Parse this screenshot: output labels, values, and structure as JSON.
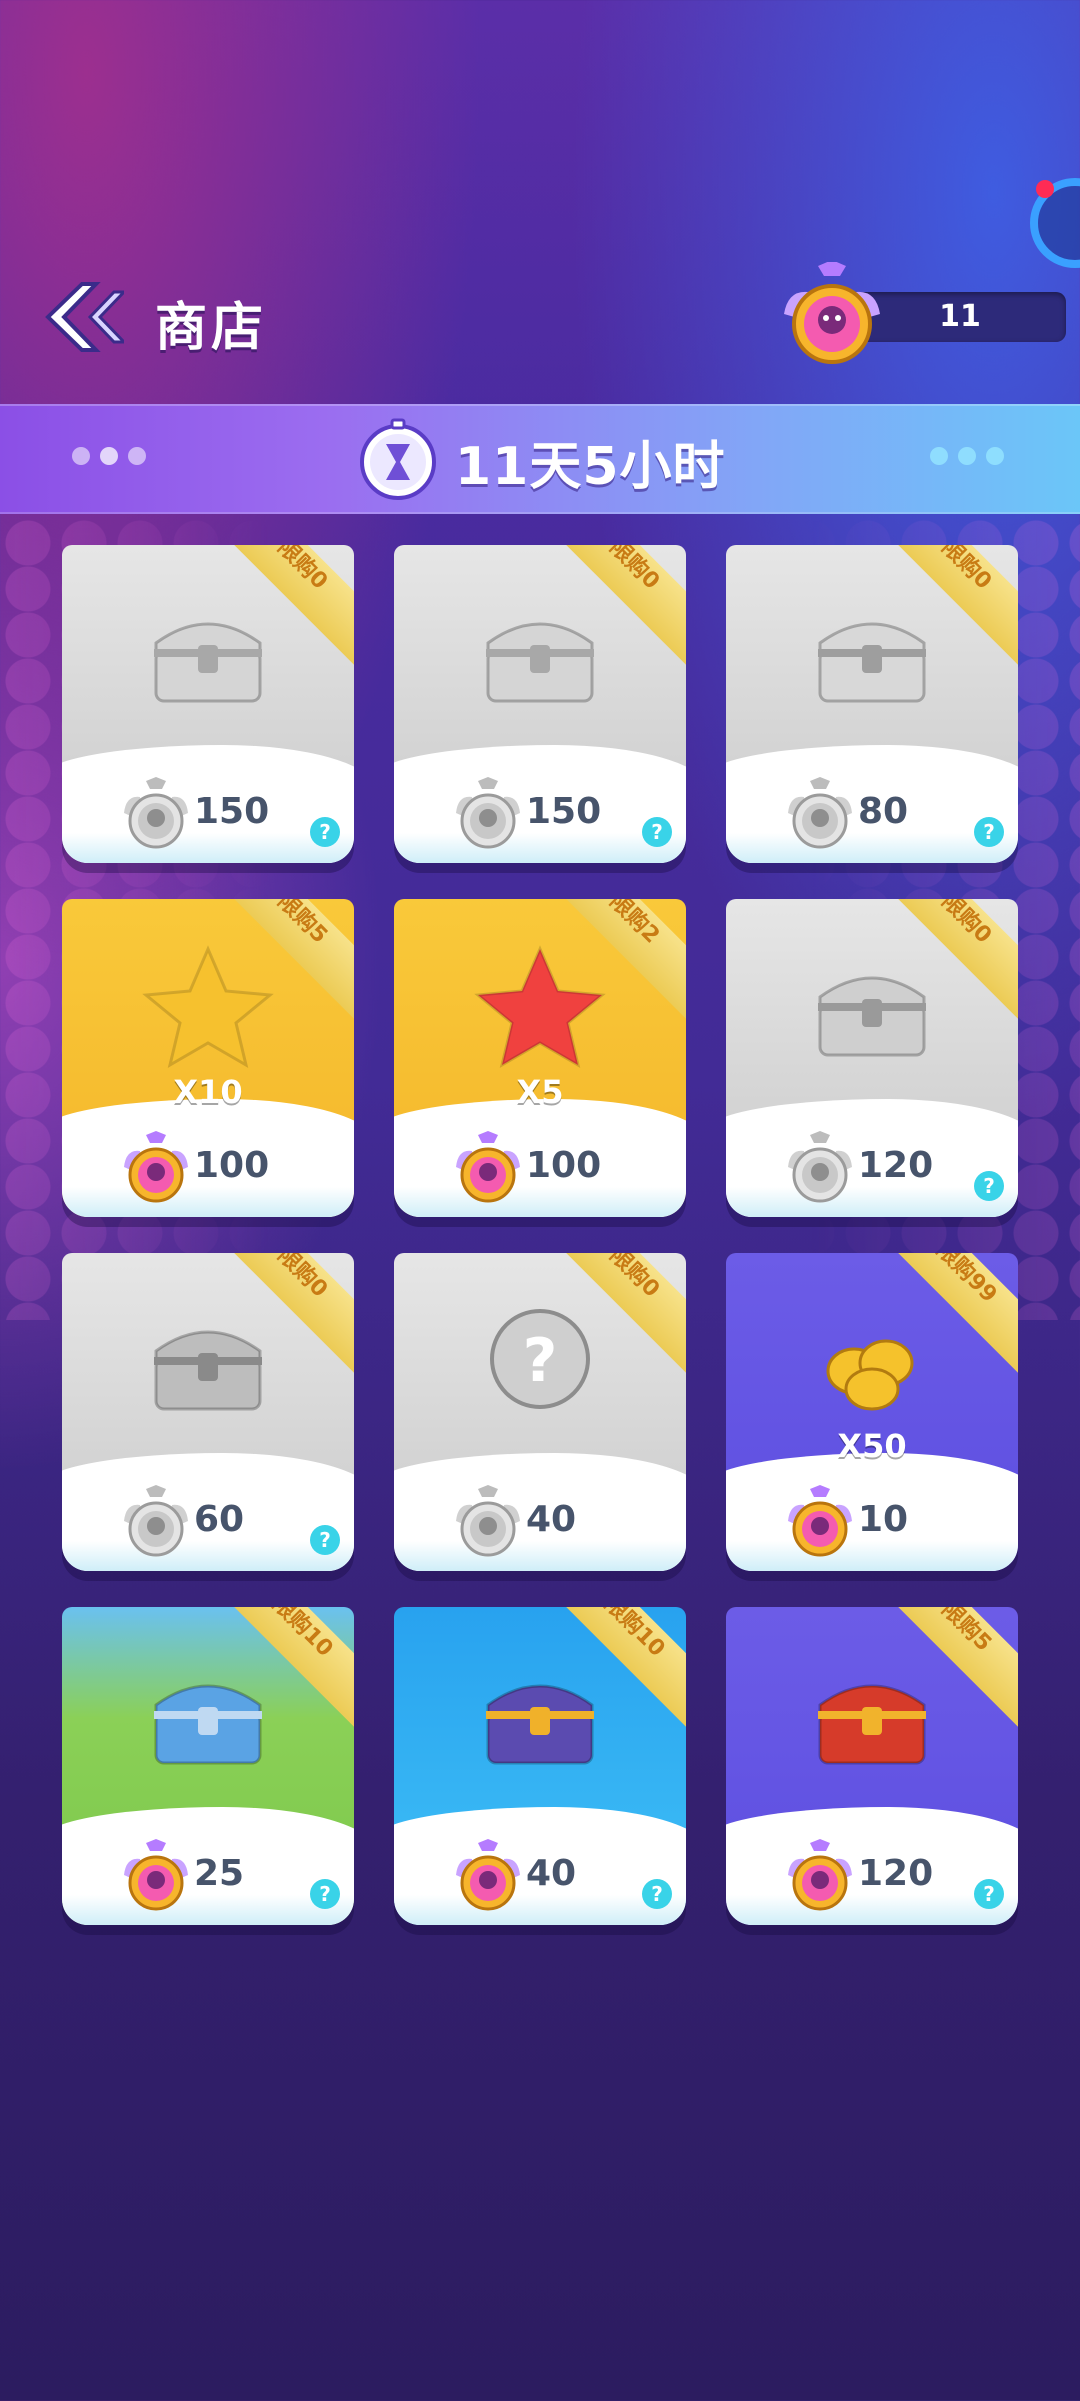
{
  "header": {
    "title": "商店",
    "currency_value": "11"
  },
  "banner": {
    "timer_text": "11天5小时"
  },
  "shop": {
    "items": [
      {
        "ribbon": "限购0",
        "price": "150",
        "mult": "",
        "bg": "gray",
        "price_icon": "silver-medal-icon",
        "art": "silver-chest-icon",
        "help": "?"
      },
      {
        "ribbon": "限购0",
        "price": "150",
        "mult": "",
        "bg": "gray",
        "price_icon": "silver-medal-icon",
        "art": "silver-chest-icon",
        "help": "?"
      },
      {
        "ribbon": "限购0",
        "price": "80",
        "mult": "",
        "bg": "gray",
        "price_icon": "silver-medal-icon",
        "art": "silver-crown-chest-icon",
        "help": "?"
      },
      {
        "ribbon": "限购5",
        "price": "100",
        "mult": "X10",
        "bg": "yellow",
        "price_icon": "pink-medal-icon",
        "art": "gold-star-icon",
        "help": ""
      },
      {
        "ribbon": "限购2",
        "price": "100",
        "mult": "X5",
        "bg": "yellow",
        "price_icon": "pink-medal-icon",
        "art": "red-star-icon",
        "help": ""
      },
      {
        "ribbon": "限购0",
        "price": "120",
        "mult": "",
        "bg": "gray",
        "price_icon": "silver-medal-icon",
        "art": "silver-cylinder-chest-icon",
        "help": "?"
      },
      {
        "ribbon": "限购0",
        "price": "60",
        "mult": "",
        "bg": "gray",
        "price_icon": "silver-medal-icon",
        "art": "silver-ornate-chest-icon",
        "help": "?"
      },
      {
        "ribbon": "限购0",
        "price": "40",
        "mult": "",
        "bg": "gray",
        "price_icon": "silver-medal-icon",
        "art": "mystery-orb-icon",
        "help": ""
      },
      {
        "ribbon": "限购99",
        "price": "10",
        "mult": "X50",
        "bg": "purple",
        "price_icon": "pink-medal-icon",
        "art": "gold-coins-icon",
        "help": ""
      },
      {
        "ribbon": "限购10",
        "price": "25",
        "mult": "",
        "bg": "green",
        "price_icon": "pink-medal-icon",
        "art": "blue-chest-icon",
        "help": "?"
      },
      {
        "ribbon": "限购10",
        "price": "40",
        "mult": "",
        "bg": "blue",
        "price_icon": "pink-medal-icon",
        "art": "purple-gold-chest-icon",
        "help": "?"
      },
      {
        "ribbon": "限购5",
        "price": "120",
        "mult": "",
        "bg": "purple",
        "price_icon": "pink-medal-icon",
        "art": "red-gold-chest-icon",
        "help": "?"
      }
    ]
  },
  "colors": {
    "price_text": "#47546b",
    "ribbon_text": "#c87b14",
    "help_badge": "#39d3e8"
  }
}
